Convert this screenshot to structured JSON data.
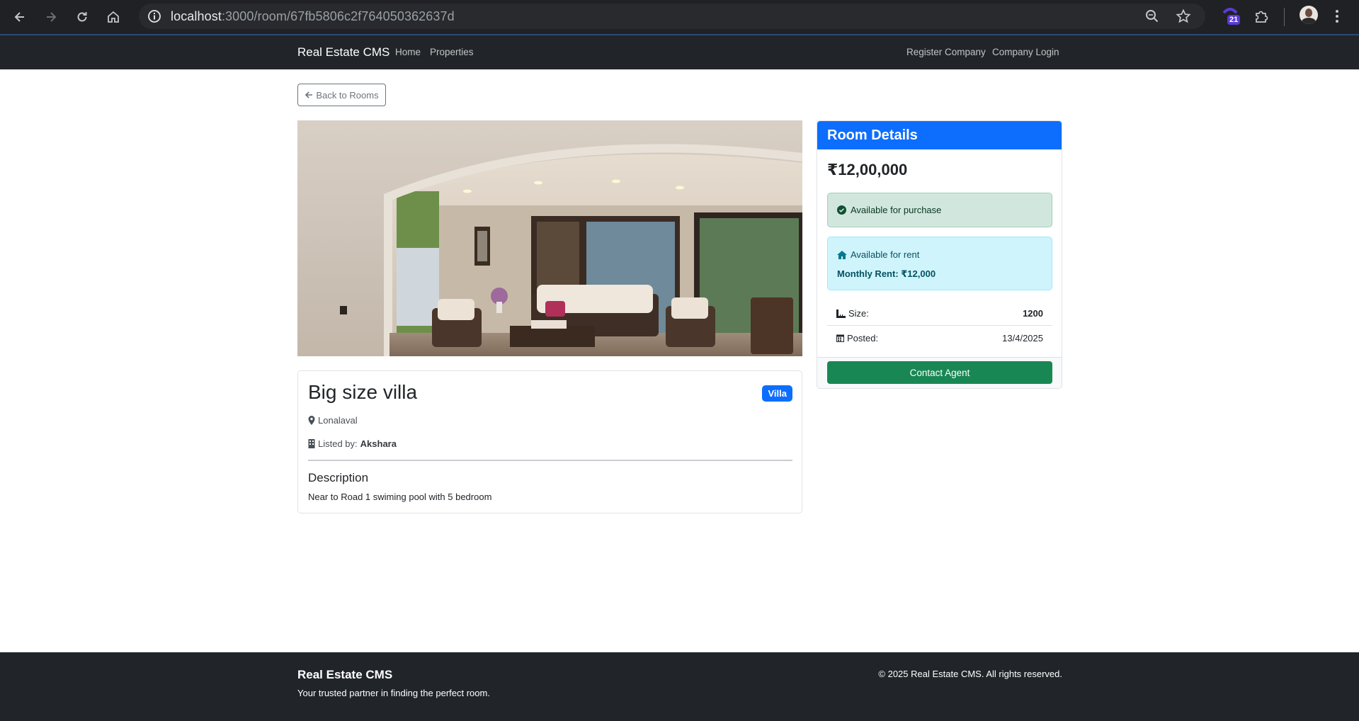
{
  "browser": {
    "url_host": "localhost",
    "url_rest": ":3000/room/67fb5806c2f764050362637d",
    "extension_badge": "21"
  },
  "navbar": {
    "brand": "Real Estate CMS",
    "links": [
      "Home",
      "Properties"
    ],
    "right_links": [
      "Register Company",
      "Company Login"
    ]
  },
  "back_button": "Back to Rooms",
  "property": {
    "title": "Big size villa",
    "type_badge": "Villa",
    "location": "Lonalaval",
    "listed_by_label": "Listed by:",
    "listed_by": "Akshara",
    "description_heading": "Description",
    "description": "Near to Road 1 swiming pool with 5 bedroom"
  },
  "details": {
    "heading": "Room Details",
    "price": "₹12,00,000",
    "purchase_status": "Available for purchase",
    "rent_status": "Available for rent",
    "monthly_rent": "Monthly Rent: ₹12,000",
    "size_label": "Size:",
    "size_value": "1200",
    "posted_label": "Posted:",
    "posted_value": "13/4/2025",
    "contact_button": "Contact Agent"
  },
  "footer": {
    "brand": "Real Estate CMS",
    "tagline": "Your trusted partner in finding the perfect room.",
    "copyright": "© 2025 Real Estate CMS. All rights reserved."
  },
  "colors": {
    "primary": "#0d6efd",
    "success": "#198754",
    "dark": "#212529"
  }
}
